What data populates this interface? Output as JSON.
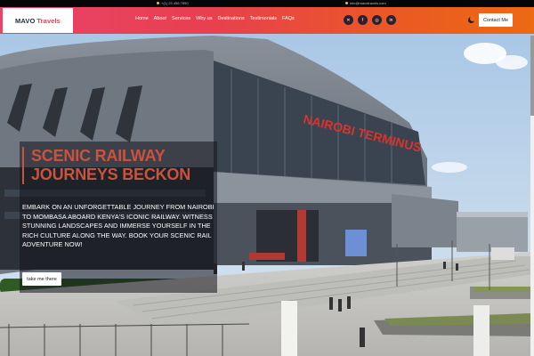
{
  "topbar": {
    "phone": "+(1) 23 456 7890",
    "email": "info@mavotravels.com"
  },
  "brand": {
    "part1": "MAVO",
    "part2": "Travels"
  },
  "nav": {
    "items": [
      "Home",
      "About",
      "Services",
      "Why us",
      "Destinations",
      "Testimonials",
      "FAQs"
    ]
  },
  "social": {
    "icons": [
      "x-icon",
      "facebook-icon",
      "instagram-icon",
      "linkedin-icon"
    ]
  },
  "contact_label": "Contact Me",
  "hero": {
    "heading": "SCENIC RAILWAY JOURNEYS BECKON",
    "text": "EMBARK ON AN UNFORGETTABLE JOURNEY FROM NAIROBI TO MOMBASA ABOARD KENYA'S ICONIC RAILWAY. WITNESS STUNNING LANDSCAPES AND IMMERSE YOURSELF IN THE RICH CULTURE ALONG THE WAY. BOOK YOUR SCENIC RAIL ADVENTURE NOW!",
    "button": "take me there",
    "sign": "NAIROBI TERMINUS"
  },
  "colors": {
    "brand_dark": "#1d2a44",
    "accent": "#e8404e",
    "heading": "#c8543f",
    "nav_start": "#e7436b",
    "nav_end": "#ec6a12"
  }
}
